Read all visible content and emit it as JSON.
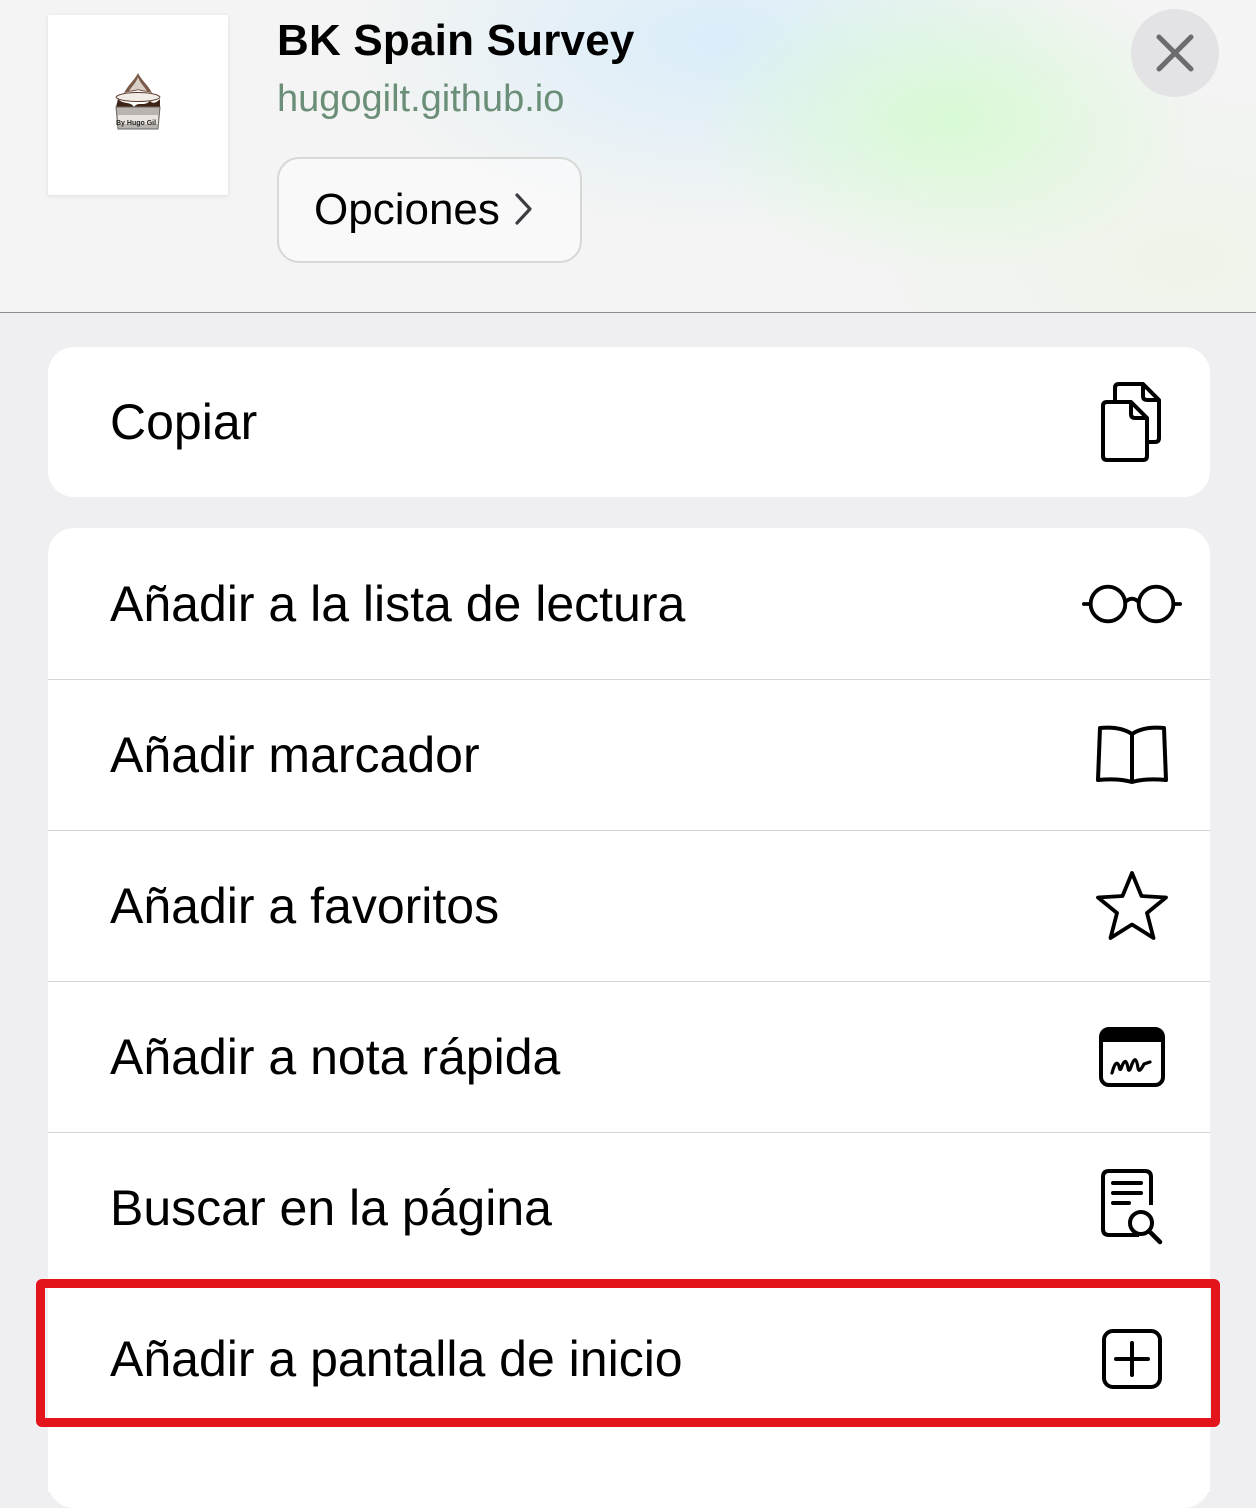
{
  "header": {
    "title": "BK Spain Survey",
    "url": "hugogilt.github.io",
    "thumbnail_caption": "By Hugo Gil",
    "options_label": "Opciones",
    "thumbnail_icon": "sundae-logo",
    "close_icon": "close-icon"
  },
  "copy_section": {
    "label": "Copiar",
    "icon": "copy-icon"
  },
  "actions": [
    {
      "label": "Añadir a la lista de lectura",
      "icon": "glasses-icon"
    },
    {
      "label": "Añadir marcador",
      "icon": "book-icon"
    },
    {
      "label": "Añadir a favoritos",
      "icon": "star-icon"
    },
    {
      "label": "Añadir a nota rápida",
      "icon": "quick-note-icon"
    },
    {
      "label": "Buscar en la página",
      "icon": "find-in-page-icon"
    },
    {
      "label": "Añadir a pantalla de inicio",
      "icon": "add-square-icon"
    }
  ],
  "highlight": {
    "target": "Añadir a pantalla de inicio",
    "color": "#e3141c"
  },
  "colors": {
    "url_text": "#6b8e78",
    "background": "#efeff1",
    "card": "#ffffff"
  }
}
